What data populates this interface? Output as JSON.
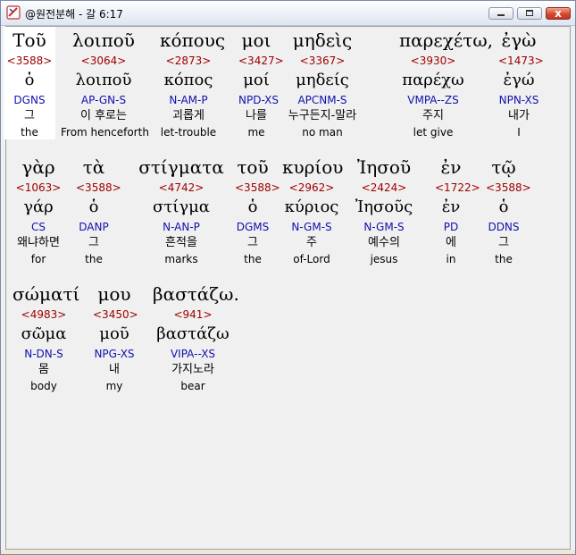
{
  "window": {
    "title": "@원전분해 - 갈 6:17",
    "buttons": {
      "minimize": "",
      "maximize": "",
      "close": "x"
    }
  },
  "lines": [
    [
      {
        "surface": "Τοῦ",
        "strong": "<3588>",
        "lemma": "ὁ",
        "morph": "DGNS",
        "korean": "그",
        "english": "the"
      },
      {
        "surface": "λοιποῦ",
        "strong": "<3064>",
        "lemma": "λοιποῦ",
        "morph": "AP-GN-S",
        "korean": "이 후로는",
        "english": "From henceforth"
      },
      {
        "surface": "κόπους",
        "strong": "<2873>",
        "lemma": "κόπος",
        "morph": "N-AM-P",
        "korean": "괴롭게",
        "english": "let-trouble"
      },
      {
        "surface": "μοι",
        "strong": "<3427>",
        "lemma": "μοί",
        "morph": "NPD-XS",
        "korean": "나를",
        "english": "me"
      },
      {
        "surface": "μηδεὶς",
        "strong": "<3367>",
        "lemma": "μηδείς",
        "morph": "APCNM-S",
        "korean": "누구든지-말라",
        "english": "no man"
      },
      {
        "surface": "παρεχέτω,",
        "strong": "<3930>",
        "lemma": "παρέχω",
        "morph": "VMPA--ZS",
        "korean": "주지",
        "english": "let give"
      },
      {
        "surface": "ἐγὼ",
        "strong": "<1473>",
        "lemma": "ἐγώ",
        "morph": "NPN-XS",
        "korean": "내가",
        "english": "I"
      }
    ],
    [
      {
        "surface": "γὰρ",
        "strong": "<1063>",
        "lemma": "γάρ",
        "morph": "CS",
        "korean": "왜냐하면",
        "english": "for"
      },
      {
        "surface": "τὰ",
        "strong": "<3588>",
        "lemma": "ὁ",
        "morph": "DANP",
        "korean": "그",
        "english": "the"
      },
      {
        "surface": "στίγματα",
        "strong": "<4742>",
        "lemma": "στίγμα",
        "morph": "N-AN-P",
        "korean": "흔적을",
        "english": "marks"
      },
      {
        "surface": "τοῦ",
        "strong": "<3588>",
        "lemma": "ὁ",
        "morph": "DGMS",
        "korean": "그",
        "english": "the"
      },
      {
        "surface": "κυρίου",
        "strong": "<2962>",
        "lemma": "κύριος",
        "morph": "N-GM-S",
        "korean": "주",
        "english": "of-Lord"
      },
      {
        "surface": "Ἰησοῦ",
        "strong": "<2424>",
        "lemma": "Ἰησοῦς",
        "morph": "N-GM-S",
        "korean": "예수의",
        "english": "jesus"
      },
      {
        "surface": "ἐν",
        "strong": "<1722>",
        "lemma": "ἐν",
        "morph": "PD",
        "korean": "에",
        "english": "in"
      },
      {
        "surface": "τῷ",
        "strong": "<3588>",
        "lemma": "ὁ",
        "morph": "DDNS",
        "korean": "그",
        "english": "the"
      }
    ],
    [
      {
        "surface": "σώματί",
        "strong": "<4983>",
        "lemma": "σῶμα",
        "morph": "N-DN-S",
        "korean": "몸",
        "english": "body"
      },
      {
        "surface": "μου",
        "strong": "<3450>",
        "lemma": "μοῦ",
        "morph": "NPG-XS",
        "korean": "내",
        "english": "my"
      },
      {
        "surface": "βαστάζω.",
        "strong": "<941>",
        "lemma": "βαστάζω",
        "morph": "VIPA--XS",
        "korean": "가지노라",
        "english": "bear"
      }
    ]
  ]
}
